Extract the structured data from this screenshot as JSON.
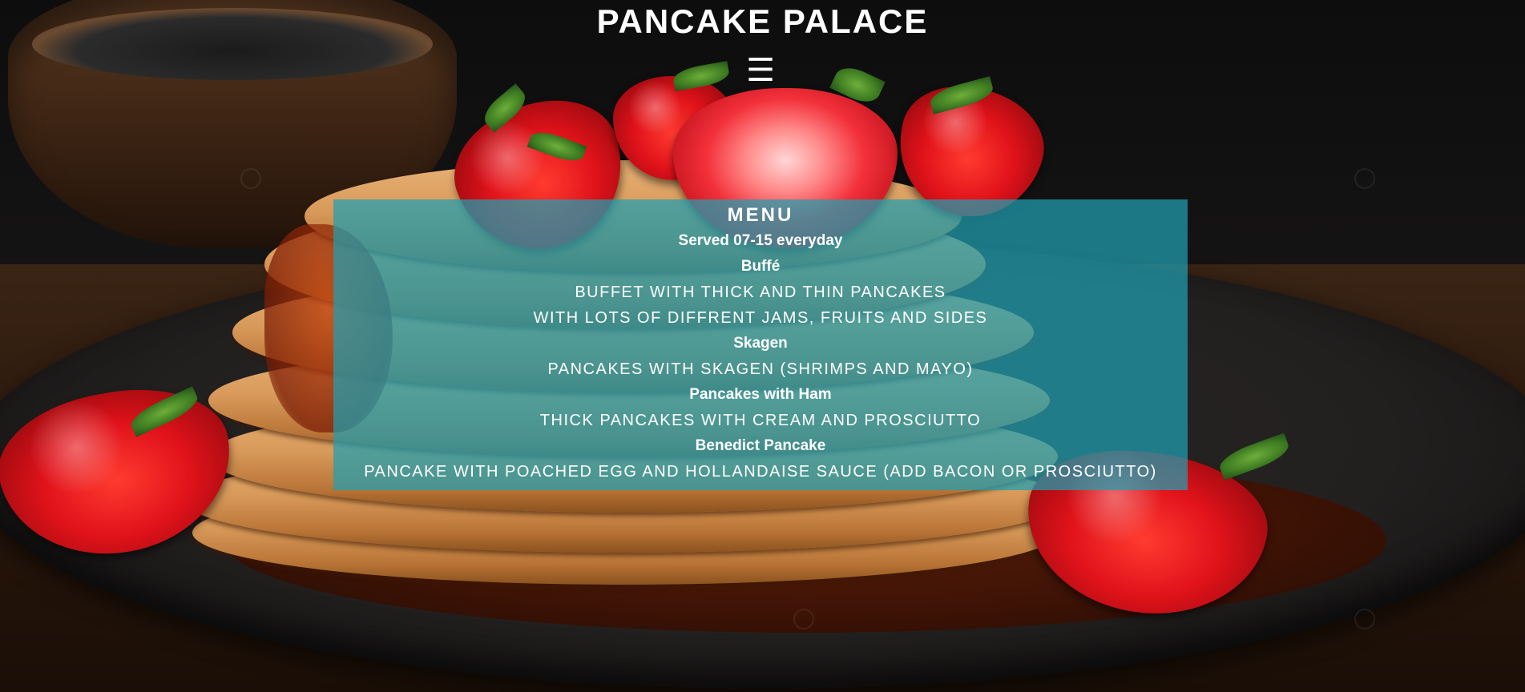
{
  "header": {
    "title": "PANCAKE PALACE",
    "menu_icon": "☰"
  },
  "menu": {
    "heading": "MENU",
    "served": "Served 07-15 everyday",
    "items": [
      {
        "name": "Buffé",
        "descriptions": [
          "BUFFET WITH THICK AND THIN PANCAKES",
          "WITH LOTS OF DIFFRENT JAMS, FRUITS AND SIDES"
        ]
      },
      {
        "name": "Skagen",
        "descriptions": [
          "PANCAKES WITH SKAGEN (SHRIMPS AND MAYO)"
        ]
      },
      {
        "name": "Pancakes with Ham",
        "descriptions": [
          "THICK PANCAKES WITH CREAM AND PROSCIUTTO"
        ]
      },
      {
        "name": "Benedict Pancake",
        "descriptions": [
          "PANCAKE WITH POACHED EGG AND HOLLANDAISE SAUCE (ADD BACON OR PROSCIUTTO)"
        ]
      }
    ]
  },
  "colors": {
    "menu_panel": "#20a0b2",
    "text": "#ffffff"
  },
  "icons": {
    "menu": "hamburger-icon"
  }
}
